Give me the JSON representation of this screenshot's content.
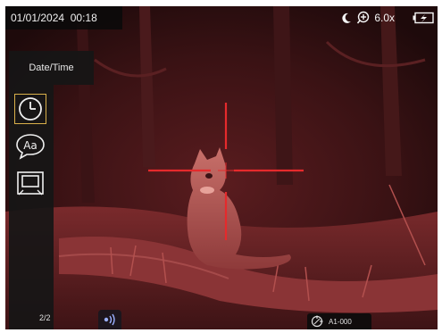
{
  "status_bar": {
    "datetime": "01/01/2024  00:18",
    "night_mode_icon": "crescent-moon-icon",
    "zoom_icon": "zoom-in-icon",
    "zoom_level": "6.0x",
    "battery_icon": "battery-charging-icon"
  },
  "menu": {
    "title": "Date/Time",
    "items": [
      {
        "icon": "clock-icon",
        "selected": true
      },
      {
        "icon": "font-speech-bubble-icon",
        "selected": false
      },
      {
        "icon": "screen-display-icon",
        "selected": false
      }
    ],
    "page": "2/2"
  },
  "bottom_bar": {
    "wifi_icon": "wifi-signal-icon",
    "profile_icon": "profile-target-icon",
    "profile_label": "A1-000"
  },
  "colors": {
    "reticle": "#e52a2c",
    "selection_border": "#d9b04a",
    "scene_tint": "#8c2a2d"
  }
}
